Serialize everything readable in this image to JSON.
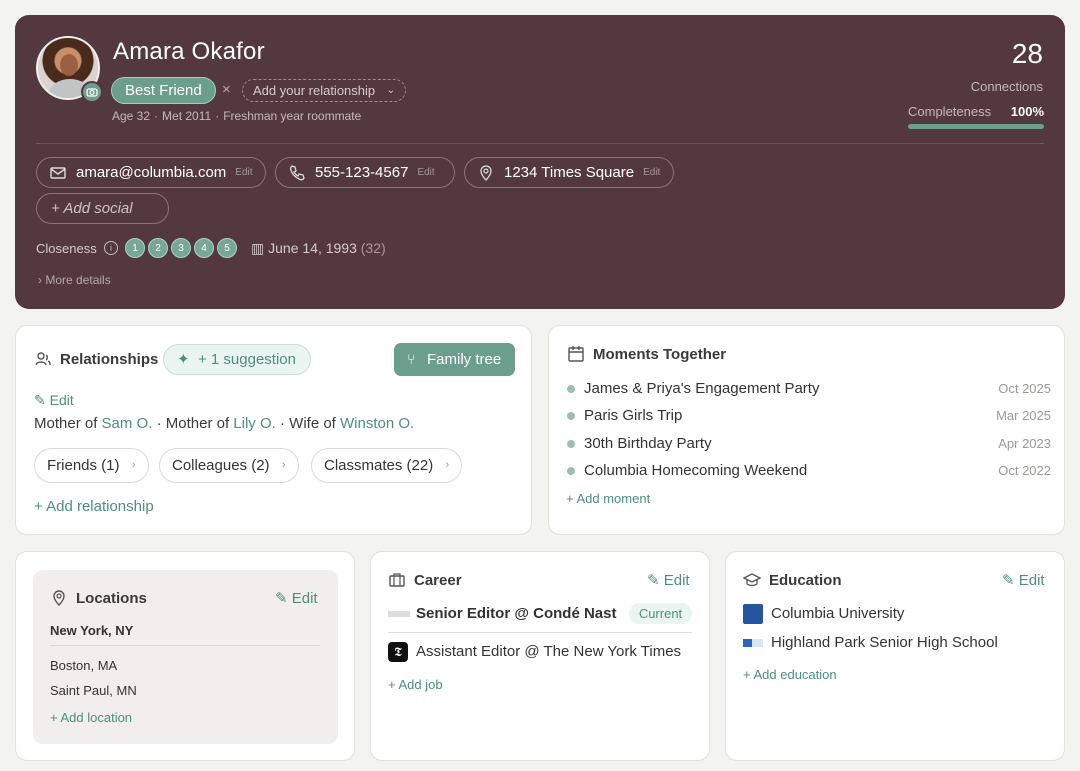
{
  "profile": {
    "name": "Amara Okafor",
    "relationship": "Best Friend",
    "remove": "×",
    "add_relationship": "Add your relationship",
    "age": "Age 32",
    "met": "Met 2011",
    "context": "Freshman year roommate",
    "sep": "·",
    "connections_count": "28",
    "connections_label": "Connections",
    "completeness_label": "Completeness",
    "completeness_value": "100%",
    "email": "amara@columbia.com",
    "phone": "555-123-4567",
    "address": "1234 Times Square",
    "edit": "Edit",
    "add_social": "+ Add social",
    "closeness_label": "Closeness",
    "closeness_levels": [
      "1",
      "2",
      "3",
      "4",
      "5"
    ],
    "birthday": "June 14, 1993",
    "birthday_age": "(32)",
    "more_details": "More details"
  },
  "relationships": {
    "title": "Relationships",
    "suggestion": "+ 1 suggestion",
    "family_tree": "Family tree",
    "edit": "Edit",
    "mother_of": "Mother of",
    "sam": "Sam O.",
    "lily": "Lily O.",
    "wife_of": "Wife of",
    "winston": "Winston O.",
    "dot": "·",
    "chips": [
      "Friends (1)",
      "Colleagues (2)",
      "Classmates (22)"
    ],
    "add": "+ Add relationship"
  },
  "moments": {
    "title": "Moments Together",
    "items": [
      {
        "title": "James & Priya's Engagement Party",
        "date": "Oct 2025"
      },
      {
        "title": "Paris Girls Trip",
        "date": "Mar 2025"
      },
      {
        "title": "30th Birthday Party",
        "date": "Apr 2023"
      },
      {
        "title": "Columbia Homecoming Weekend",
        "date": "Oct 2022"
      }
    ],
    "add": "+ Add moment"
  },
  "locations": {
    "title": "Locations",
    "edit": "Edit",
    "primary": "New York, NY",
    "others": [
      "Boston, MA",
      "Saint Paul, MN"
    ],
    "add": "+ Add location"
  },
  "career": {
    "title": "Career",
    "edit": "Edit",
    "current_job": "Senior Editor @ Condé Nast",
    "current_badge": "Current",
    "past_job": "Assistant Editor @ The New York Times",
    "add": "+ Add job"
  },
  "education": {
    "title": "Education",
    "edit": "Edit",
    "schools": [
      "Columbia University",
      "Highland Park Senior High School"
    ],
    "add": "+ Add education"
  }
}
